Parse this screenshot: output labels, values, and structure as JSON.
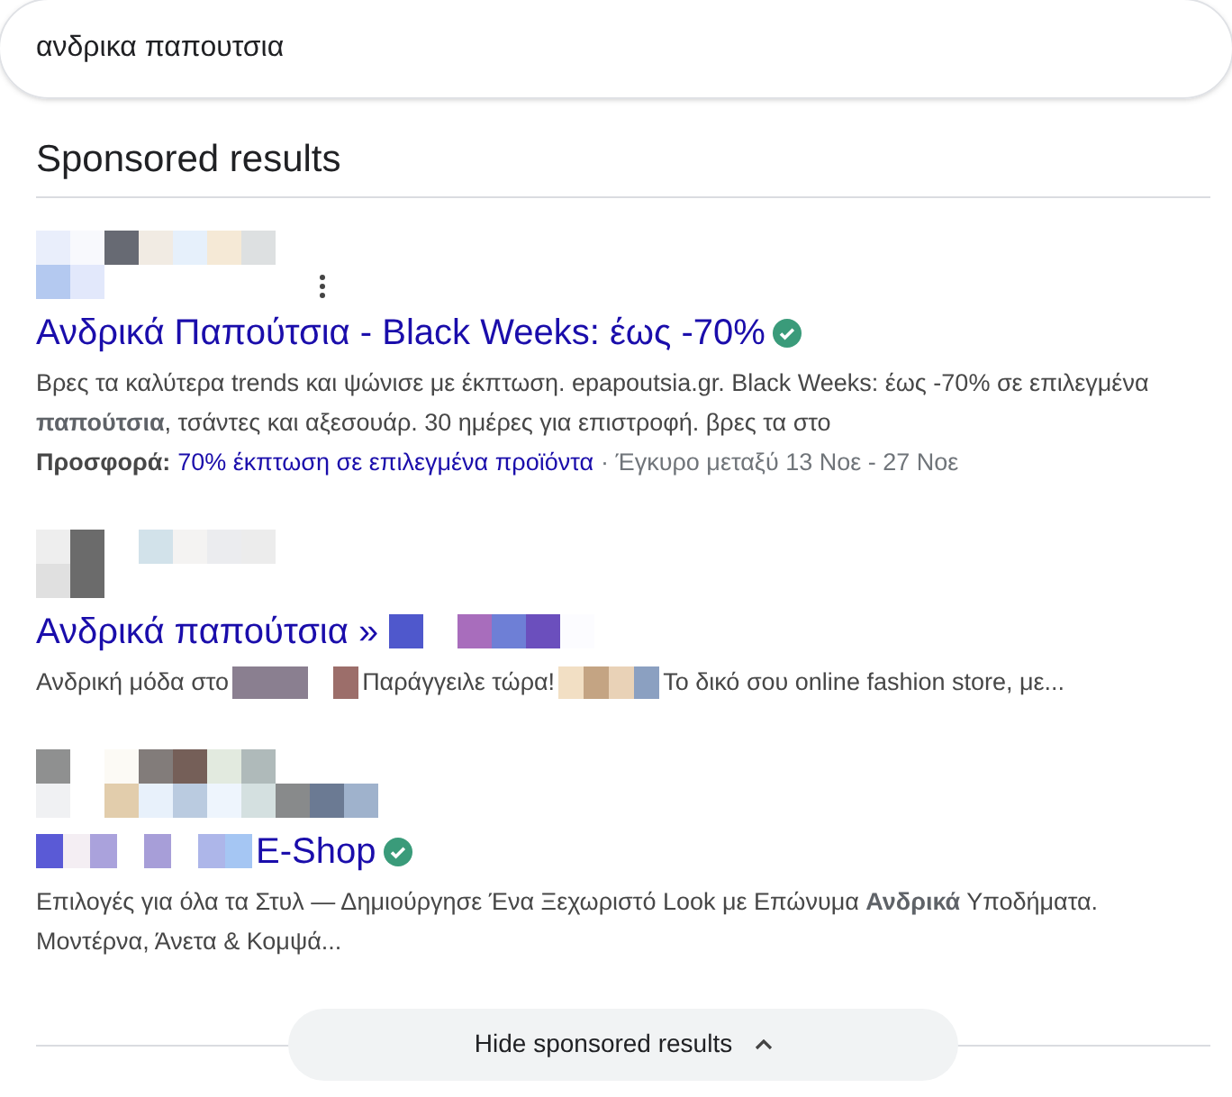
{
  "search": {
    "value": "ανδρικα παπουτσια"
  },
  "heading": "Sponsored results",
  "results": [
    {
      "title": "Ανδρικά Παπούτσια - Black Weeks: έως -70%",
      "verified": true,
      "has_menu": true,
      "title_mosaic_lead": false,
      "description": "Βρες τα καλύτερα trends και ψώνισε με έκπτωση. epapoutsia.gr. Black Weeks: έως -70% σε επιλεγμένα **παπούτσια**, τσάντες και αξεσουάρ. 30 ημέρες για επιστροφή. βρες τα στο",
      "offer": {
        "label": "Προσφορά:",
        "link": "70% έκπτωση σε επιλεγμένα προϊόντα",
        "validity": "· Έγκυρο μεταξύ 13 Νοε - 27 Νοε"
      }
    },
    {
      "title": "Ανδρικά παπούτσια »",
      "verified": false,
      "has_menu": false,
      "title_mosaic_lead": false,
      "description_parts": [
        "Ανδρική μόδα στο",
        "Παράγγειλε τώρα!",
        "Το δικό σου online fashion store, με..."
      ]
    },
    {
      "title": "E-Shop",
      "verified": true,
      "has_menu": false,
      "title_mosaic_lead": true,
      "description": "Επιλογές για όλα τα Στυλ — Δημιούργησε Ένα Ξεχωριστό Look με Επώνυμα **Ανδρικά** Υποδήματα. Μοντέρνα, Άνετα & Κομψά..."
    }
  ],
  "hide_button": {
    "label": "Hide sponsored results"
  }
}
